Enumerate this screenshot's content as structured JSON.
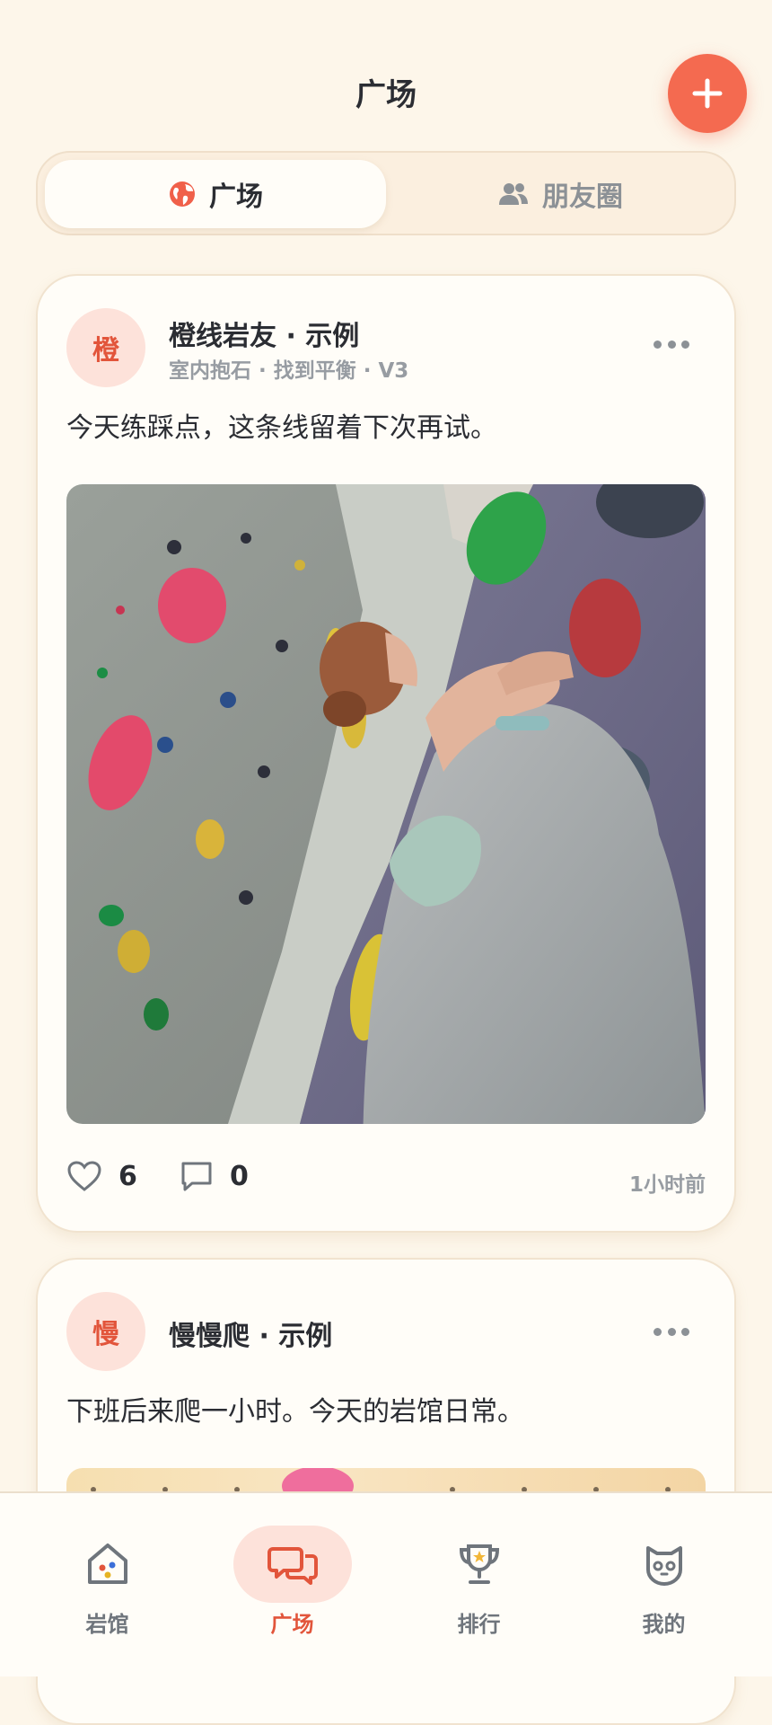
{
  "header": {
    "title": "广场"
  },
  "segments": [
    {
      "label": "广场",
      "icon": "globe-icon",
      "active": true
    },
    {
      "label": "朋友圈",
      "icon": "users-icon",
      "active": false
    }
  ],
  "posts": [
    {
      "avatar_char": "橙",
      "author": "橙线岩友 · 示例",
      "meta": "室内抱石 · 找到平衡 · V3",
      "text": "今天练踩点，这条线留着下次再试。",
      "likes": "6",
      "comments": "0",
      "time": "1小时前"
    },
    {
      "avatar_char": "慢",
      "author": "慢慢爬 · 示例",
      "text": "下班后来爬一小时。今天的岩馆日常。"
    }
  ],
  "tabbar": [
    {
      "label": "岩馆",
      "icon": "gym-house-icon",
      "active": false
    },
    {
      "label": "广场",
      "icon": "chat-bubbles-icon",
      "active": true
    },
    {
      "label": "排行",
      "icon": "trophy-icon",
      "active": false
    },
    {
      "label": "我的",
      "icon": "cat-face-icon",
      "active": false
    }
  ],
  "colors": {
    "accent": "#f46a50",
    "background": "#fdf6ea",
    "card": "#fffdf8",
    "muted": "#8c9196"
  }
}
